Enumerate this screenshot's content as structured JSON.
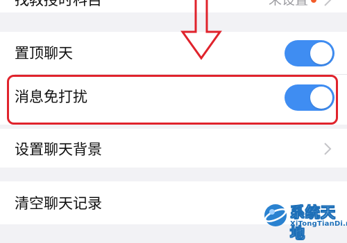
{
  "settings": {
    "rows": [
      {
        "label": "找教授时科目",
        "value": "未设置",
        "type": "value"
      },
      {
        "label": "置顶聊天",
        "type": "toggle",
        "on": true
      },
      {
        "label": "消息免打扰",
        "type": "toggle",
        "on": true,
        "highlighted": true
      },
      {
        "label": "设置聊天背景",
        "type": "chevron"
      },
      {
        "label": "清空聊天记录",
        "type": "action"
      }
    ]
  },
  "colors": {
    "toggle_on": "#3f8df2",
    "highlight": "#e0232c",
    "badge_dot": "#f25c2a"
  },
  "watermark": {
    "title": "系统天地",
    "subtitle": "XiTongTianDi.net"
  }
}
